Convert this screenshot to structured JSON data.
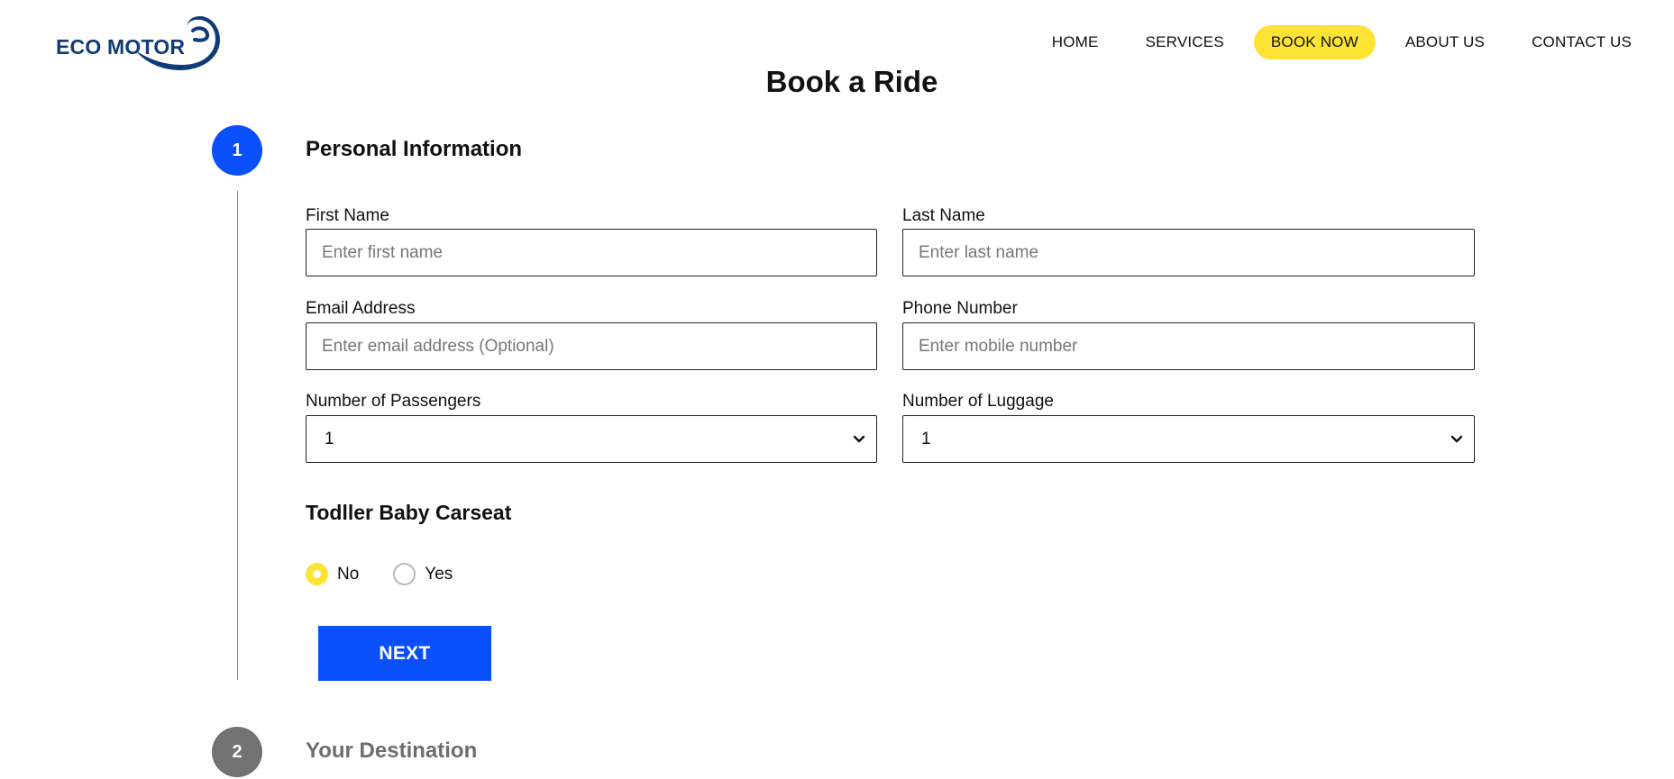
{
  "brand": {
    "name": "ECO MOTOR",
    "color": "#0f3c78"
  },
  "nav": {
    "items": [
      {
        "label": "HOME"
      },
      {
        "label": "SERVICES"
      },
      {
        "label": "BOOK NOW",
        "active": true
      },
      {
        "label": "ABOUT US"
      },
      {
        "label": "CONTACT US"
      }
    ]
  },
  "page": {
    "title": "Book a Ride"
  },
  "steps": [
    {
      "number": "1",
      "title": "Personal Information",
      "status": "active"
    },
    {
      "number": "2",
      "title": "Your Destination",
      "status": "inactive"
    }
  ],
  "form": {
    "first_name": {
      "label": "First Name",
      "placeholder": "Enter first name",
      "value": ""
    },
    "last_name": {
      "label": "Last Name",
      "placeholder": "Enter last name",
      "value": ""
    },
    "email": {
      "label": "Email Address",
      "placeholder": "Enter email address (Optional)",
      "value": ""
    },
    "phone": {
      "label": "Phone Number",
      "placeholder": "Enter mobile number",
      "value": ""
    },
    "passengers": {
      "label": "Number of Passengers",
      "value": "1"
    },
    "luggage": {
      "label": "Number of Luggage",
      "value": "1"
    },
    "carseat": {
      "heading": "Todller Baby Carseat",
      "options": [
        {
          "label": "No",
          "checked": true
        },
        {
          "label": "Yes",
          "checked": false
        }
      ]
    },
    "next_label": "NEXT"
  },
  "colors": {
    "accent_blue": "#0a4ffc",
    "highlight_yellow": "#fde334",
    "inactive_gray": "#727272"
  }
}
